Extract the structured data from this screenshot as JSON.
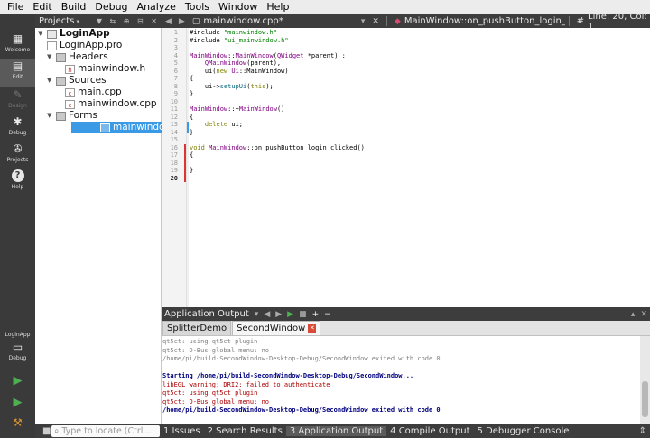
{
  "menu": [
    "File",
    "Edit",
    "Build",
    "Debug",
    "Analyze",
    "Tools",
    "Window",
    "Help"
  ],
  "modes": [
    {
      "label": "Welcome",
      "icon": "grid-icon"
    },
    {
      "label": "Edit",
      "icon": "edit-icon"
    },
    {
      "label": "Design",
      "icon": "pencil-icon"
    },
    {
      "label": "Debug",
      "icon": "bug-icon"
    },
    {
      "label": "Projects",
      "icon": "wrench-icon"
    },
    {
      "label": "Help",
      "icon": "help-icon"
    }
  ],
  "kit": {
    "project": "LoginApp",
    "label": "Debug"
  },
  "projects": {
    "title": "Projects",
    "tree": [
      {
        "label": "LoginApp",
        "bold": true
      },
      {
        "label": "LoginApp.pro"
      },
      {
        "label": "Headers"
      },
      {
        "label": "mainwindow.h"
      },
      {
        "label": "Sources"
      },
      {
        "label": "main.cpp"
      },
      {
        "label": "mainwindow.cpp"
      },
      {
        "label": "Forms"
      },
      {
        "label": "mainwindow.ui"
      }
    ]
  },
  "editor": {
    "file_tab": "mainwindow.cpp*",
    "symbol": "MainWindow::on_pushButton_login_clicked(): v...",
    "hash": "#",
    "position": "Line: 20, Col: 1",
    "line_numbers": [
      "1",
      "2",
      "3",
      "4",
      "5",
      "6",
      "7",
      "8",
      "9",
      "10",
      "11",
      "12",
      "13",
      "14",
      "15",
      "16",
      "17",
      "18",
      "19",
      "20"
    ],
    "code": [
      "#include \"mainwindow.h\"",
      "#include \"ui_mainwindow.h\"",
      "",
      "MainWindow::MainWindow(QWidget *parent) :",
      "    QMainWindow(parent),",
      "    ui(new Ui::MainWindow)",
      "{",
      "    ui->setupUi(this);",
      "}",
      "",
      "MainWindow::~MainWindow()",
      "{",
      "    delete ui;",
      "}",
      "",
      "void MainWindow::on_pushButton_login_clicked()",
      "{",
      "",
      "}",
      ""
    ]
  },
  "output": {
    "title": "Application Output",
    "tabs": [
      "SplitterDemo",
      "SecondWindow"
    ],
    "lines": [
      {
        "text": "qt5ct: using qt5ct plugin",
        "cls": "o-gray"
      },
      {
        "text": "qt5ct: D-Bus global menu: no",
        "cls": "o-gray"
      },
      {
        "text": "/home/pi/build-SecondWindow-Desktop-Debug/SecondWindow exited with code 0",
        "cls": "o-gray"
      },
      {
        "text": "",
        "cls": "o-gray"
      },
      {
        "text": "Starting /home/pi/build-SecondWindow-Desktop-Debug/SecondWindow...",
        "cls": "o-blue"
      },
      {
        "text": "libEGL warning: DRI2: failed to authenticate",
        "cls": "o-red"
      },
      {
        "text": "qt5ct: using qt5ct plugin",
        "cls": "o-red"
      },
      {
        "text": "qt5ct: D-Bus global menu: no",
        "cls": "o-red"
      },
      {
        "text": "/home/pi/build-SecondWindow-Desktop-Debug/SecondWindow exited with code 0",
        "cls": "o-blue"
      }
    ]
  },
  "status": {
    "locator_placeholder": "Type to locate (Ctrl...",
    "panes": [
      "1 Issues",
      "2 Search Results",
      "3 Application Output",
      "4 Compile Output",
      "5 Debugger Console"
    ]
  },
  "colors": {
    "selection": "#3a9ae6",
    "error_mark": "#d33333",
    "close_badge": "#d94a38"
  }
}
